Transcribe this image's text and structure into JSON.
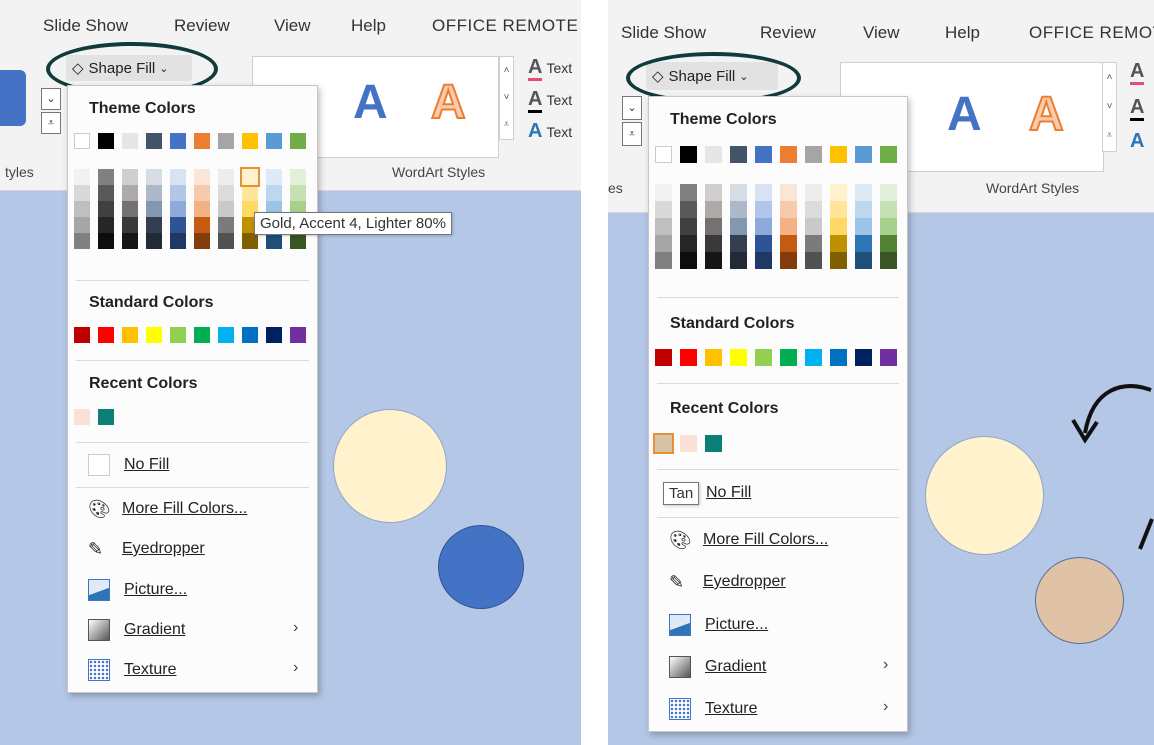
{
  "ribbon": {
    "tabs": [
      "Slide Show",
      "Review",
      "View",
      "Help",
      "OFFICE REMOTE"
    ],
    "tabs_right": [
      "Slide Show",
      "Review",
      "View",
      "Help",
      "OFFICE REMOT"
    ],
    "shape_fill_label": "Shape Fill",
    "shape_styles_group_left": "tyles",
    "shape_styles_group_right": "es",
    "wordart_group_label": "WordArt Styles",
    "wordart_sample": "A",
    "text_option_label": "Text",
    "colors": {
      "accent": "#0f3b3b",
      "ribbon_bg": "#f3f3f3"
    }
  },
  "menu": {
    "theme_colors_title": "Theme Colors",
    "standard_colors_title": "Standard Colors",
    "recent_colors_title": "Recent Colors",
    "no_fill_label": "No Fill",
    "more_fill_colors_label": "More Fill Colors...",
    "eyedropper_label": "Eyedropper",
    "picture_label": "Picture...",
    "gradient_label": "Gradient",
    "texture_label": "Texture",
    "theme_base": [
      "#ffffff",
      "#000000",
      "#e7e6e6",
      "#44546a",
      "#4472c4",
      "#ed7d31",
      "#a5a5a5",
      "#ffc000",
      "#5b9bd5",
      "#70ad47"
    ],
    "theme_shades": [
      [
        "#f2f2f2",
        "#d9d9d9",
        "#bfbfbf",
        "#a6a6a6",
        "#808080"
      ],
      [
        "#808080",
        "#595959",
        "#404040",
        "#262626",
        "#0d0d0d"
      ],
      [
        "#d0cece",
        "#aeaaaa",
        "#757171",
        "#3a3838",
        "#171616"
      ],
      [
        "#d6dce4",
        "#adb9ca",
        "#8497b0",
        "#333f4f",
        "#222a35"
      ],
      [
        "#d9e2f3",
        "#b4c6e7",
        "#8eaadb",
        "#2f5496",
        "#1f3864"
      ],
      [
        "#fbe5d5",
        "#f7caac",
        "#f4b183",
        "#c55a11",
        "#833c0b"
      ],
      [
        "#ededed",
        "#dbdbdb",
        "#c9c9c9",
        "#7b7b7b",
        "#525252"
      ],
      [
        "#fff2cc",
        "#ffe599",
        "#ffd966",
        "#bf9000",
        "#7f6000"
      ],
      [
        "#deebf6",
        "#bdd7ee",
        "#9dc3e6",
        "#2e75b5",
        "#1f4e79"
      ],
      [
        "#e2efd9",
        "#c5e0b3",
        "#a8d08d",
        "#538135",
        "#375623"
      ]
    ],
    "standard": [
      "#c00000",
      "#ff0000",
      "#ffc000",
      "#ffff00",
      "#92d050",
      "#00b050",
      "#00b0f0",
      "#0070c0",
      "#002060",
      "#7030a0"
    ],
    "recent_left": [
      "#fbe0d6",
      "#0b8077"
    ],
    "recent_right": [
      "#d9c3a5",
      "#fbe0d6",
      "#0b8077"
    ]
  },
  "tooltips": {
    "left": "Gold, Accent 4, Lighter 80%",
    "right": "Tan"
  },
  "canvas": {
    "slide_bg": "#b4c7e7",
    "circle_cream": "#fff2cc",
    "circle_blue": "#4472c4",
    "circle_tan": "#e0c3a6",
    "circle_border": "#8fa6c8"
  }
}
